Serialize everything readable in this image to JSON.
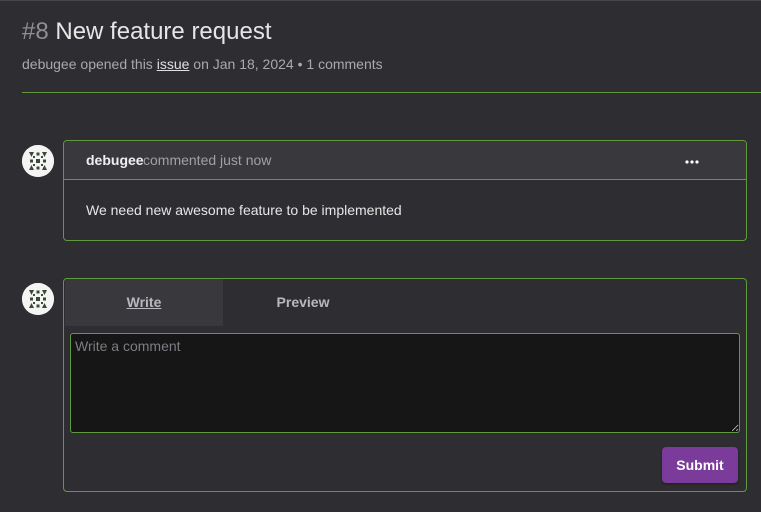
{
  "issue": {
    "number": "#8",
    "title": "New feature request",
    "meta_author": "debugee",
    "meta_opened": "opened this",
    "meta_link": "issue",
    "meta_date": "on Jan 18, 2024",
    "meta_separator": "•",
    "meta_comments": "1 comments"
  },
  "comment": {
    "author": "debugee",
    "action": "commented just now",
    "body": "We need new awesome feature to be implemented",
    "menu_icon": "more-horizontal-icon"
  },
  "editor": {
    "tab_write": "Write",
    "tab_preview": "Preview",
    "placeholder": "Write a comment",
    "value": "",
    "submit_label": "Submit"
  },
  "colors": {
    "border_accent": "#5f9b3e",
    "submit": "#7b3b9b",
    "background": "#2e2e32"
  }
}
